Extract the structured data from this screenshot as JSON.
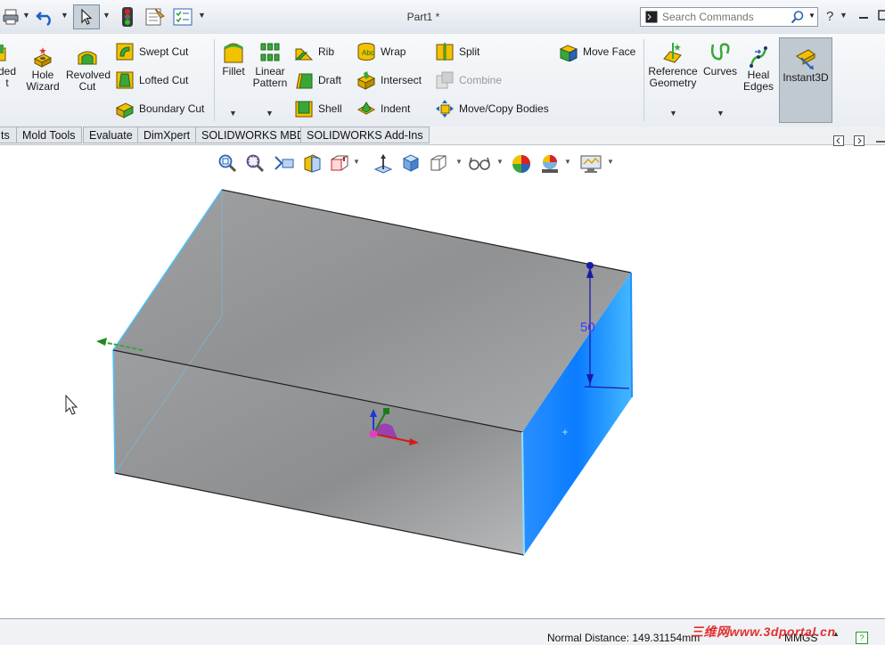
{
  "titlebar": {
    "document_title": "Part1 *",
    "search_placeholder": "Search Commands",
    "help_label": "?"
  },
  "ribbon": {
    "partial_left_label_line1": "ded",
    "partial_left_label_line2": "t",
    "hole_wizard_label": "Hole Wizard",
    "revolved_cut_label": "Revolved Cut",
    "swept_cut_label": "Swept Cut",
    "lofted_cut_label": "Lofted Cut",
    "boundary_cut_label": "Boundary Cut",
    "fillet_label": "Fillet",
    "linear_pattern_label": "Linear Pattern",
    "rib_label": "Rib",
    "draft_label": "Draft",
    "shell_label": "Shell",
    "wrap_label": "Wrap",
    "intersect_label": "Intersect",
    "indent_label": "Indent",
    "split_label": "Split",
    "combine_label": "Combine",
    "move_copy_bodies_label": "Move/Copy Bodies",
    "move_face_label": "Move Face",
    "reference_geometry_label": "Reference Geometry",
    "curves_label": "Curves",
    "heal_edges_label": "Heal Edges",
    "instant3d_label": "Instant3D"
  },
  "tabs": [
    {
      "label": "ts"
    },
    {
      "label": "Mold Tools"
    },
    {
      "label": "Evaluate"
    },
    {
      "label": "DimXpert"
    },
    {
      "label": "SOLIDWORKS MBD"
    },
    {
      "label": "SOLIDWORKS Add-Ins"
    }
  ],
  "viewport": {
    "dimension_value": "50"
  },
  "status": {
    "normal_distance": "Normal Distance: 149.31154mm",
    "units": "MMGS",
    "watermark": "三维网www.3dportal.cn"
  },
  "colors": {
    "selected_face": "#1e90ff",
    "dimension": "#1a1aa8",
    "ribbon_icon_yellow": "#f2c200",
    "ribbon_icon_green": "#3aa63a"
  }
}
